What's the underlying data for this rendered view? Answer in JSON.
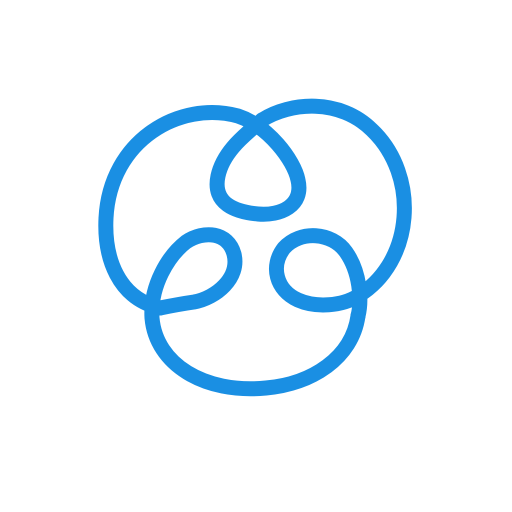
{
  "logo": {
    "name": "triple-loop-teardrop-mark",
    "icon": "trefoil-knot-icon",
    "stroke_color": "#1a8fe3",
    "background_color": "#ffffff"
  }
}
